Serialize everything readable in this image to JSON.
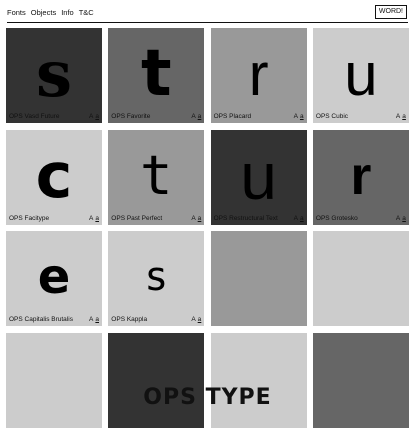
{
  "nav": {
    "items": [
      "Fonts",
      "Objects",
      "Info",
      "T&C"
    ]
  },
  "header": {
    "word_button": "WORD!"
  },
  "tiles": [
    {
      "name": "OPS Vasd Future",
      "glyph": "s",
      "bg": "#333333",
      "fg": "#000000",
      "aa": "A",
      "aa_under": "a"
    },
    {
      "name": "OPS Favorite",
      "glyph": "t",
      "bg": "#666666",
      "fg": "#000000",
      "aa": "A",
      "aa_under": "a"
    },
    {
      "name": "OPS Placard",
      "glyph": "r",
      "bg": "#999999",
      "fg": "#000000",
      "aa": "A",
      "aa_under": "a"
    },
    {
      "name": "OPS Cubic",
      "glyph": "u",
      "bg": "#cccccc",
      "fg": "#000000",
      "aa": "A",
      "aa_under": "a"
    },
    {
      "name": "OPS Facitype",
      "glyph": "c",
      "bg": "#cccccc",
      "fg": "#000000",
      "aa": "A",
      "aa_under": "a"
    },
    {
      "name": "OPS Past Perfect",
      "glyph": "t",
      "bg": "#999999",
      "fg": "#000000",
      "aa": "A",
      "aa_under": "a"
    },
    {
      "name": "OPS Restructural Text",
      "glyph": "u",
      "bg": "#333333",
      "fg": "#000000",
      "aa": "A",
      "aa_under": "a"
    },
    {
      "name": "OPS Grotesko",
      "glyph": "r",
      "bg": "#666666",
      "fg": "#000000",
      "aa": "A",
      "aa_under": "a"
    },
    {
      "name": "OPS Capitalis Brutalis",
      "glyph": "e",
      "bg": "#cccccc",
      "fg": "#000000",
      "aa": "A",
      "aa_under": "a"
    },
    {
      "name": "OPS Kappla",
      "glyph": "s",
      "bg": "#cccccc",
      "fg": "#000000",
      "aa": "A",
      "aa_under": "a"
    },
    {
      "name": "",
      "glyph": "",
      "bg": "#999999",
      "fg": "#000000",
      "aa": "",
      "aa_under": ""
    },
    {
      "name": "",
      "glyph": "",
      "bg": "#cccccc",
      "fg": "#000000",
      "aa": "",
      "aa_under": ""
    },
    {
      "name": "",
      "glyph": "",
      "bg": "#cccccc",
      "fg": "#000000",
      "aa": "",
      "aa_under": ""
    },
    {
      "name": "",
      "glyph": "",
      "bg": "#333333",
      "fg": "#000000",
      "aa": "",
      "aa_under": ""
    },
    {
      "name": "",
      "glyph": "",
      "bg": "#cccccc",
      "fg": "#000000",
      "aa": "",
      "aa_under": ""
    },
    {
      "name": "",
      "glyph": "",
      "bg": "#666666",
      "fg": "#000000",
      "aa": "",
      "aa_under": ""
    }
  ],
  "footer": {
    "title": "OPS TYPE"
  }
}
